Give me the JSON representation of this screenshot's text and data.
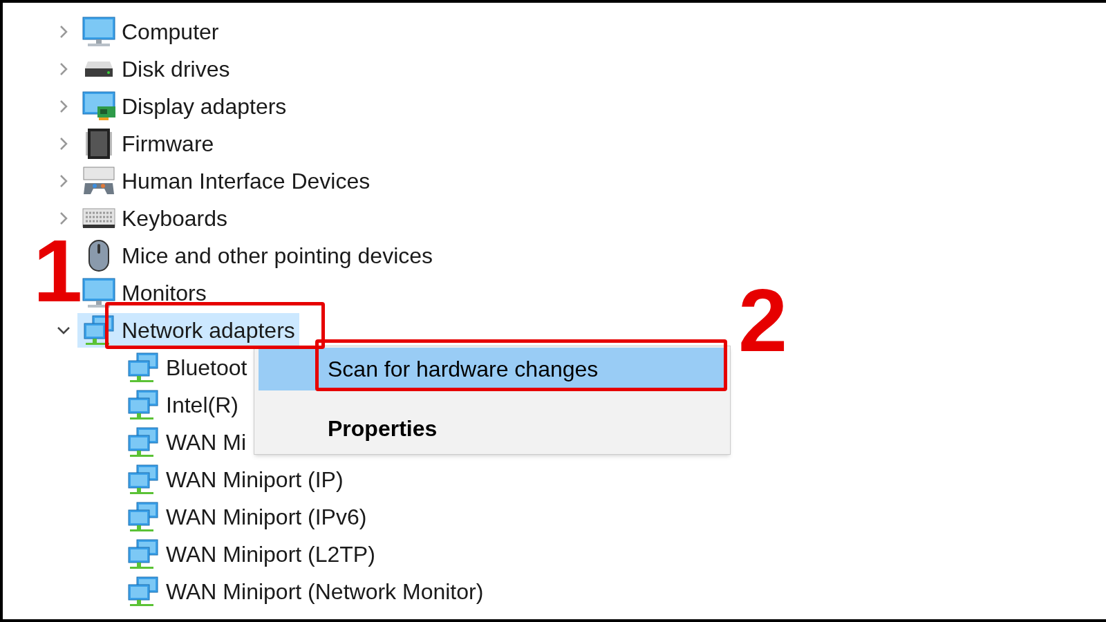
{
  "tree": [
    {
      "label": "Computer",
      "kind": "computer",
      "expanded": false,
      "selected": false
    },
    {
      "label": "Disk drives",
      "kind": "disk",
      "expanded": false,
      "selected": false
    },
    {
      "label": "Display adapters",
      "kind": "display",
      "expanded": false,
      "selected": false
    },
    {
      "label": "Firmware",
      "kind": "chip",
      "expanded": false,
      "selected": false
    },
    {
      "label": "Human Interface Devices",
      "kind": "hid",
      "expanded": false,
      "selected": false
    },
    {
      "label": "Keyboards",
      "kind": "keyboard",
      "expanded": false,
      "selected": false
    },
    {
      "label": "Mice and other pointing devices",
      "kind": "mouse",
      "selected": false
    },
    {
      "label": "Monitors",
      "kind": "computer",
      "selected": false
    },
    {
      "label": "Network adapters",
      "kind": "network",
      "expanded": true,
      "selected": true,
      "children": [
        {
          "label": "Bluetoot",
          "kind": "network",
          "selected": false
        },
        {
          "label": "Intel(R)",
          "kind": "network",
          "selected": false
        },
        {
          "label": "WAN Mi",
          "kind": "network",
          "selected": false
        },
        {
          "label": "WAN Miniport (IP)",
          "kind": "network",
          "selected": false
        },
        {
          "label": "WAN Miniport (IPv6)",
          "kind": "network",
          "selected": false
        },
        {
          "label": "WAN Miniport (L2TP)",
          "kind": "network",
          "selected": false
        },
        {
          "label": "WAN Miniport (Network Monitor)",
          "kind": "network",
          "selected": false
        }
      ]
    }
  ],
  "context_menu": {
    "items": [
      {
        "label": "Scan for hardware changes",
        "selected": true,
        "bold": false
      },
      {
        "label": "Properties",
        "selected": false,
        "bold": true
      }
    ]
  },
  "annotations": [
    {
      "number": "1"
    },
    {
      "number": "2"
    }
  ]
}
